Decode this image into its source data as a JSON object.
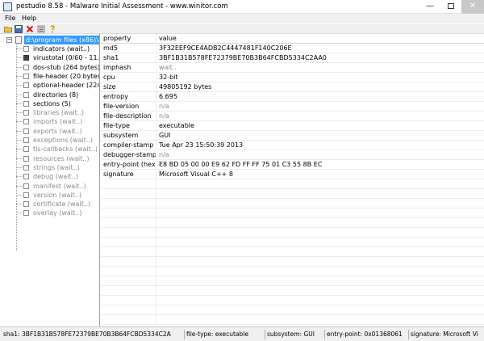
{
  "window": {
    "title": "pestudio 8.58 - Malware Initial Assessment - www.winitor.com"
  },
  "menu": {
    "file": "File",
    "help": "Help"
  },
  "toolbar": [
    "open-icon",
    "save-icon",
    "delete-icon",
    "list-icon",
    "help-icon"
  ],
  "tree": {
    "root": "d:\\program files (x86)\\ado",
    "items": [
      {
        "label": "indicators (wait..)",
        "icon": "indicators-icon",
        "state": "normal"
      },
      {
        "label": "virustotal (0/60 - 11.04.2",
        "icon": "virustotal-icon",
        "state": "normal"
      },
      {
        "label": "dos-stub (264 bytes)",
        "icon": "dos-stub-icon",
        "state": "normal"
      },
      {
        "label": "file-header (20 bytes)",
        "icon": "file-header-icon",
        "state": "normal"
      },
      {
        "label": "optional-header (224 by",
        "icon": "optional-header-icon",
        "state": "normal"
      },
      {
        "label": "directories (8)",
        "icon": "directories-icon",
        "state": "normal"
      },
      {
        "label": "sections (5)",
        "icon": "sections-icon",
        "state": "normal"
      },
      {
        "label": "libraries (wait..)",
        "icon": "libraries-icon",
        "state": "pending"
      },
      {
        "label": "imports (wait..)",
        "icon": "imports-icon",
        "state": "pending"
      },
      {
        "label": "exports (wait..)",
        "icon": "exports-icon",
        "state": "pending"
      },
      {
        "label": "exceptions (wait..)",
        "icon": "exceptions-icon",
        "state": "pending"
      },
      {
        "label": "tls-callbacks (wait..)",
        "icon": "tls-callbacks-icon",
        "state": "pending"
      },
      {
        "label": "resources (wait..)",
        "icon": "resources-icon",
        "state": "pending"
      },
      {
        "label": "strings (wait..)",
        "icon": "strings-icon",
        "state": "pending"
      },
      {
        "label": "debug (wait..)",
        "icon": "debug-icon",
        "state": "pending"
      },
      {
        "label": "manifest (wait..)",
        "icon": "manifest-icon",
        "state": "pending"
      },
      {
        "label": "version (wait..)",
        "icon": "version-icon",
        "state": "pending"
      },
      {
        "label": "certificate (wait..)",
        "icon": "certificate-icon",
        "state": "pending"
      },
      {
        "label": "overlay (wait..)",
        "icon": "overlay-icon",
        "state": "pending"
      }
    ]
  },
  "grid": {
    "columns": {
      "property": "property",
      "value": "value"
    },
    "rows": [
      {
        "property": "md5",
        "value": "3F32EEF9CE4ADB2C4447481F140C206E"
      },
      {
        "property": "sha1",
        "value": "3BF1B31B578FE72379BE70B3B64FCBD5334C2AA0"
      },
      {
        "property": "imphash",
        "value": "wait..",
        "pending": true
      },
      {
        "property": "cpu",
        "value": "32-bit"
      },
      {
        "property": "size",
        "value": "49805192 bytes"
      },
      {
        "property": "entropy",
        "value": "6.695"
      },
      {
        "property": "file-version",
        "value": "n/a",
        "pending": true
      },
      {
        "property": "file-description",
        "value": "n/a",
        "pending": true
      },
      {
        "property": "file-type",
        "value": "executable"
      },
      {
        "property": "subsystem",
        "value": "GUI"
      },
      {
        "property": "compiler-stamp",
        "value": "Tue Apr 23 15:50:39 2013"
      },
      {
        "property": "debugger-stamp",
        "value": "n/a",
        "pending": true
      },
      {
        "property": "entry-point (hex)",
        "value": "E8 BD 05 00 00 E9 62 FD FF FF 75 01 C3 55 8B EC"
      },
      {
        "property": "signature",
        "value": "Microsoft Visual C++ 8"
      }
    ]
  },
  "status": {
    "sha1": "sha1: 3BF1B31B578FE72379BE70B3B64FCBD5334C2A",
    "cpu": "cpu: 32-bit",
    "filetype": "file-type: executable",
    "subsystem": "subsystem: GUI",
    "entry": "entry-point: 0x01368061",
    "signature": "signature: Microsoft Vi"
  },
  "colors": {
    "selection": "#3399ff",
    "pending": "#8a8a8a",
    "chrome": "#f0f0f0"
  }
}
